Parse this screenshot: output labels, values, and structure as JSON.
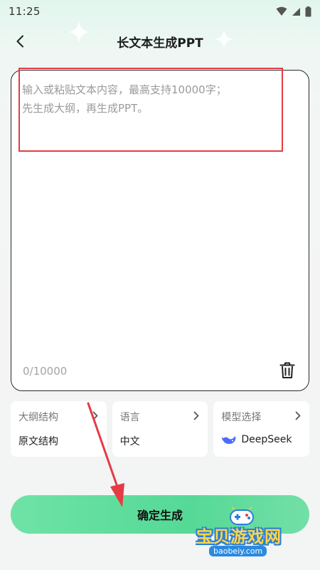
{
  "status_bar": {
    "time": "11:25"
  },
  "header": {
    "title": "长文本生成PPT"
  },
  "editor": {
    "placeholder": "输入或粘贴文本内容，最高支持10000字；\n先生成大纲，再生成PPT。",
    "counter": "0/10000"
  },
  "options": [
    {
      "label": "大纲结构",
      "value": "原文结构"
    },
    {
      "label": "语言",
      "value": "中文"
    },
    {
      "label": "模型选择",
      "value": "DeepSeek",
      "icon": "deepseek-whale-icon"
    }
  ],
  "confirm_label": "确定生成",
  "watermark": {
    "name": "宝贝游戏网",
    "url": "baobeiy.com"
  },
  "colors": {
    "accent_green": "#55d996",
    "annotation_red": "#e53b44",
    "deepseek_blue": "#4d6bfe"
  }
}
